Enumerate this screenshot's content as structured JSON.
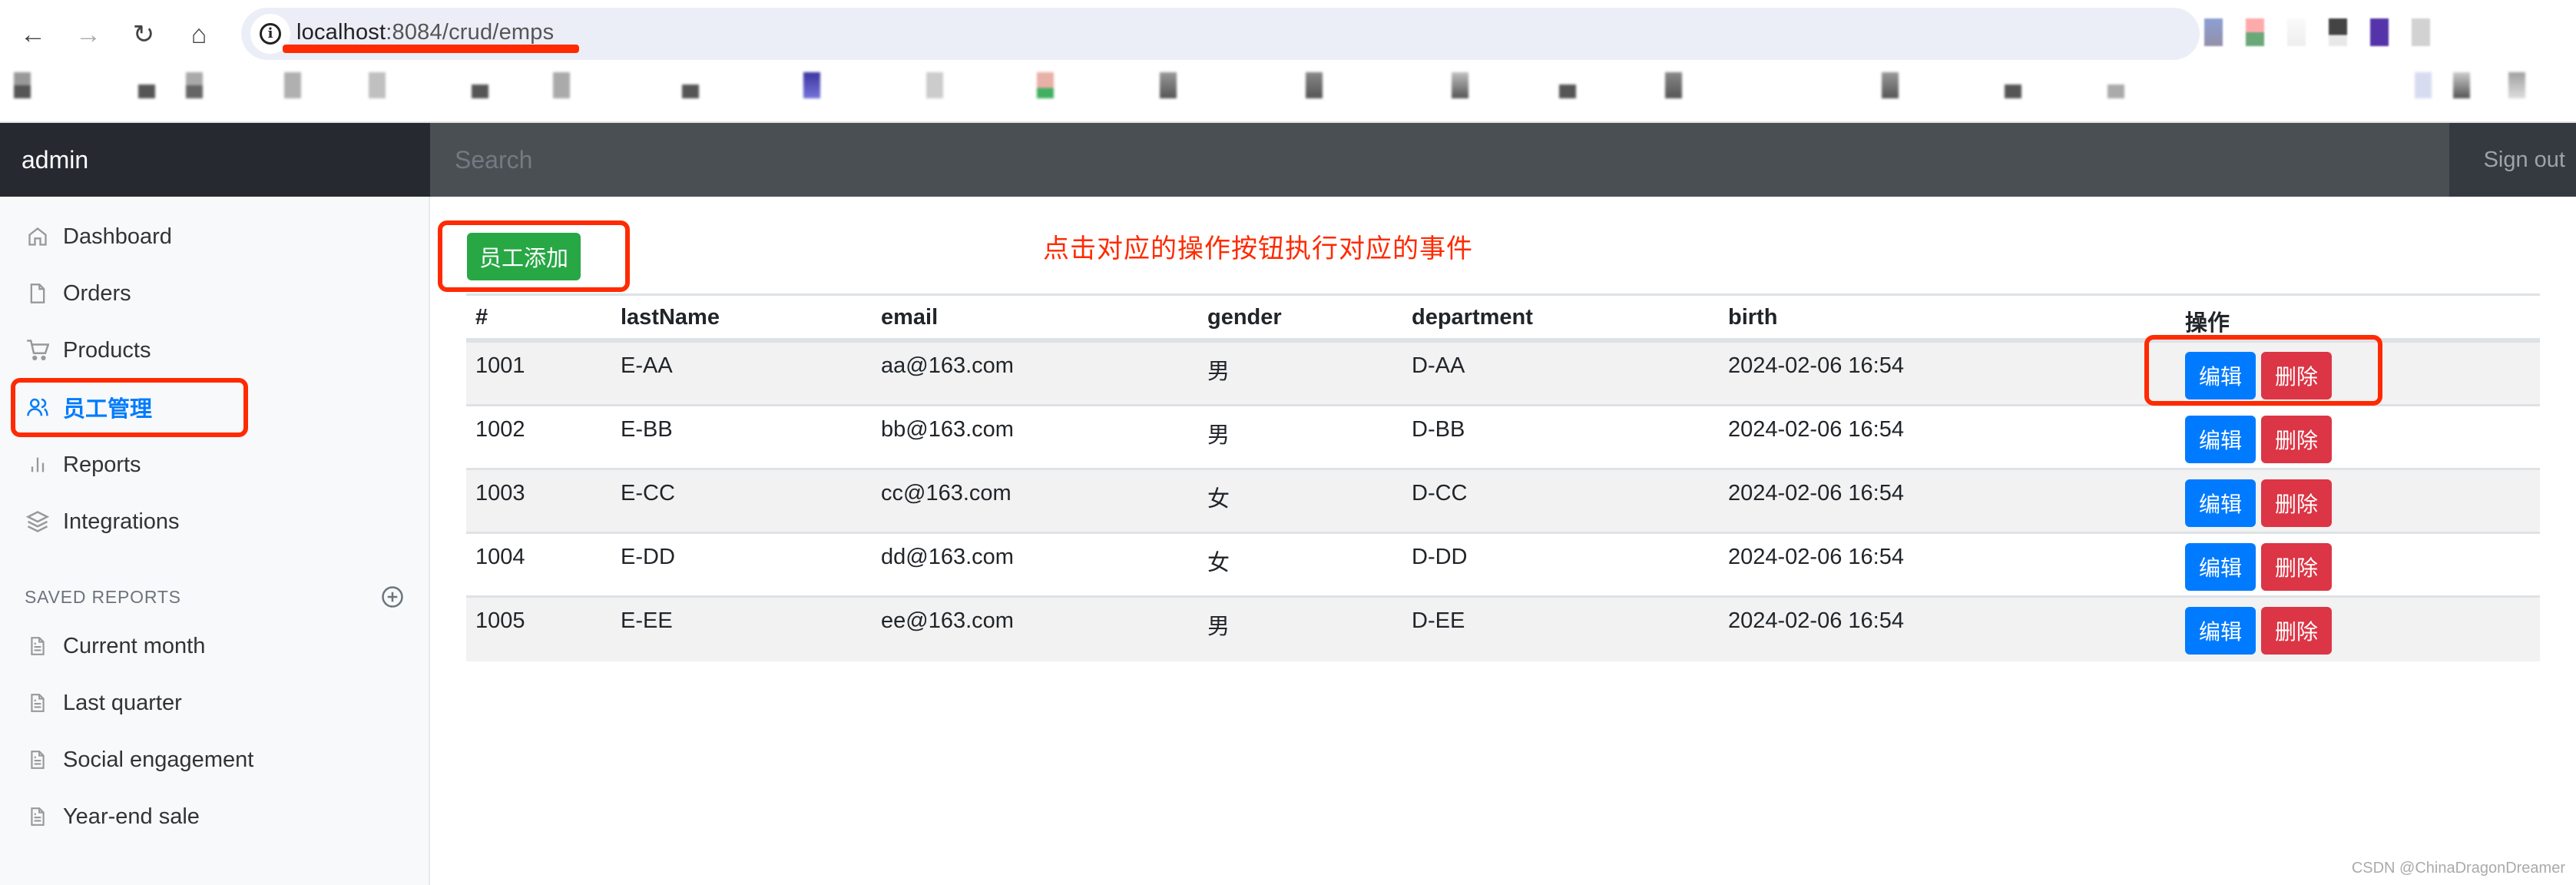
{
  "browser": {
    "url_host": "localhost",
    "url_path": ":8084/crud/emps",
    "back_icon": "←",
    "forward_icon": "→",
    "reload_icon": "↻",
    "home_icon": "⌂",
    "info_icon": "i"
  },
  "navbar": {
    "brand": "admin",
    "search_placeholder": "Search",
    "signout_label": "Sign out"
  },
  "sidebar": {
    "items": [
      {
        "label": "Dashboard",
        "icon": "home-icon"
      },
      {
        "label": "Orders",
        "icon": "file-icon"
      },
      {
        "label": "Products",
        "icon": "cart-icon"
      },
      {
        "label": "员工管理",
        "icon": "users-icon",
        "active": true
      },
      {
        "label": "Reports",
        "icon": "bar-chart-icon"
      },
      {
        "label": "Integrations",
        "icon": "layers-icon"
      }
    ],
    "saved_reports_heading": "SAVED REPORTS",
    "saved_reports": [
      {
        "label": "Current month"
      },
      {
        "label": "Last quarter"
      },
      {
        "label": "Social engagement"
      },
      {
        "label": "Year-end sale"
      }
    ]
  },
  "main": {
    "add_button_label": "员工添加",
    "annotation": "点击对应的操作按钮执行对应的事件",
    "table": {
      "headers": [
        "#",
        "lastName",
        "email",
        "gender",
        "department",
        "birth",
        "操作"
      ],
      "rows": [
        {
          "id": "1001",
          "lastName": "E-AA",
          "email": "aa@163.com",
          "gender": "男",
          "department": "D-AA",
          "birth": "2024-02-06 16:54"
        },
        {
          "id": "1002",
          "lastName": "E-BB",
          "email": "bb@163.com",
          "gender": "男",
          "department": "D-BB",
          "birth": "2024-02-06 16:54"
        },
        {
          "id": "1003",
          "lastName": "E-CC",
          "email": "cc@163.com",
          "gender": "女",
          "department": "D-CC",
          "birth": "2024-02-06 16:54"
        },
        {
          "id": "1004",
          "lastName": "E-DD",
          "email": "dd@163.com",
          "gender": "女",
          "department": "D-DD",
          "birth": "2024-02-06 16:54"
        },
        {
          "id": "1005",
          "lastName": "E-EE",
          "email": "ee@163.com",
          "gender": "男",
          "department": "D-EE",
          "birth": "2024-02-06 16:54"
        }
      ],
      "edit_label": "编辑",
      "delete_label": "删除"
    }
  },
  "colors": {
    "primary": "#007bff",
    "success": "#28a745",
    "danger": "#dc3545",
    "annotation_red": "#ff2a00",
    "navbar_dark": "#262a30"
  },
  "watermark": "CSDN @ChinaDragonDreamer"
}
